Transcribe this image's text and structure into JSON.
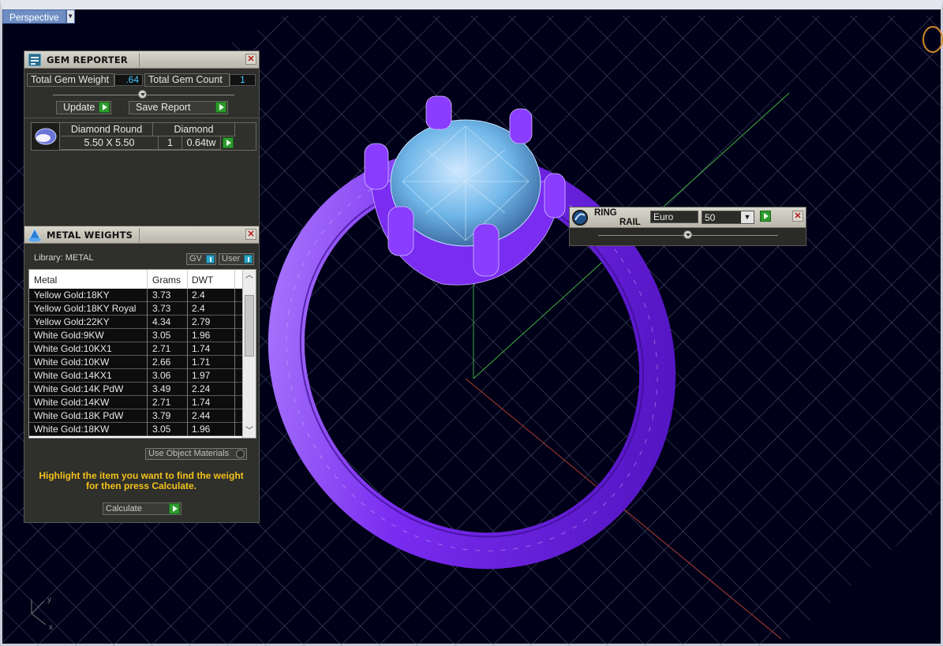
{
  "viewport": {
    "tab_label": "Perspective",
    "axis_y": "y",
    "axis_x": "x"
  },
  "gem_reporter": {
    "title": "GEM REPORTER",
    "total_weight_label": "Total Gem Weight",
    "total_weight_value": ".64",
    "total_count_label": "Total Gem Count",
    "total_count_value": "1",
    "update_label": "Update",
    "save_report_label": "Save Report",
    "gems": [
      {
        "shape": "Diamond Round",
        "material": "Diamond",
        "size": "5.50 X 5.50",
        "count": "1",
        "weight": "0.64tw"
      }
    ]
  },
  "metal_weights": {
    "title": "METAL WEIGHTS",
    "library_label": "Library: METAL",
    "toggle_gv": "GV",
    "toggle_user": "User",
    "columns": [
      "Metal",
      "Grams",
      "DWT"
    ],
    "rows": [
      [
        "Yellow Gold:18KY",
        "3.73",
        "2.4"
      ],
      [
        "Yellow Gold:18KY Royal",
        "3.73",
        "2.4"
      ],
      [
        "Yellow Gold:22KY",
        "4.34",
        "2.79"
      ],
      [
        "White Gold:9KW",
        "3.05",
        "1.96"
      ],
      [
        "White Gold:10KX1",
        "2.71",
        "1.74"
      ],
      [
        "White Gold:10KW",
        "2.66",
        "1.71"
      ],
      [
        "White Gold:14KX1",
        "3.06",
        "1.97"
      ],
      [
        "White Gold:14K PdW",
        "3.49",
        "2.24"
      ],
      [
        "White Gold:14KW",
        "2.71",
        "1.74"
      ],
      [
        "White Gold:18K PdW",
        "3.79",
        "2.44"
      ],
      [
        "White Gold:18KW",
        "3.05",
        "1.96"
      ]
    ],
    "use_object_materials_label": "Use Object Materials",
    "hint_line1": "Highlight the item you want to find the weight",
    "hint_line2": "for then press Calculate.",
    "calculate_label": "Calculate"
  },
  "ring_rail": {
    "title_line1": "RING",
    "title_line2": "RAIL",
    "profile_value": "Euro",
    "size_value": "50"
  },
  "colors": {
    "ring": "#7a2cf0",
    "gem": "#6fb6e8",
    "grid": "#9aa0c0",
    "accent_play": "#2e9a2e",
    "hint": "#f2c21a"
  }
}
